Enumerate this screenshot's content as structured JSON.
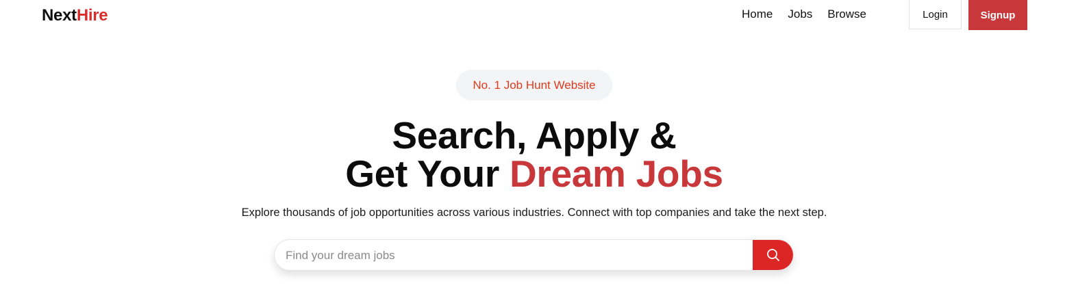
{
  "brand": {
    "name_prefix": "Next",
    "name_suffix": "Hire",
    "accent_color": "#c8373a"
  },
  "nav": {
    "links": [
      "Home",
      "Jobs",
      "Browse"
    ],
    "login_label": "Login",
    "signup_label": "Signup"
  },
  "hero": {
    "badge": "No. 1 Job Hunt Website",
    "headline_line1": "Search, Apply &",
    "headline_line2_prefix": "Get Your ",
    "headline_line2_accent": "Dream Jobs",
    "subtext": "Explore thousands of job opportunities across various industries. Connect with top companies and take the next step."
  },
  "search": {
    "placeholder": "Find your dream jobs",
    "value": "",
    "button_icon": "search-icon"
  }
}
